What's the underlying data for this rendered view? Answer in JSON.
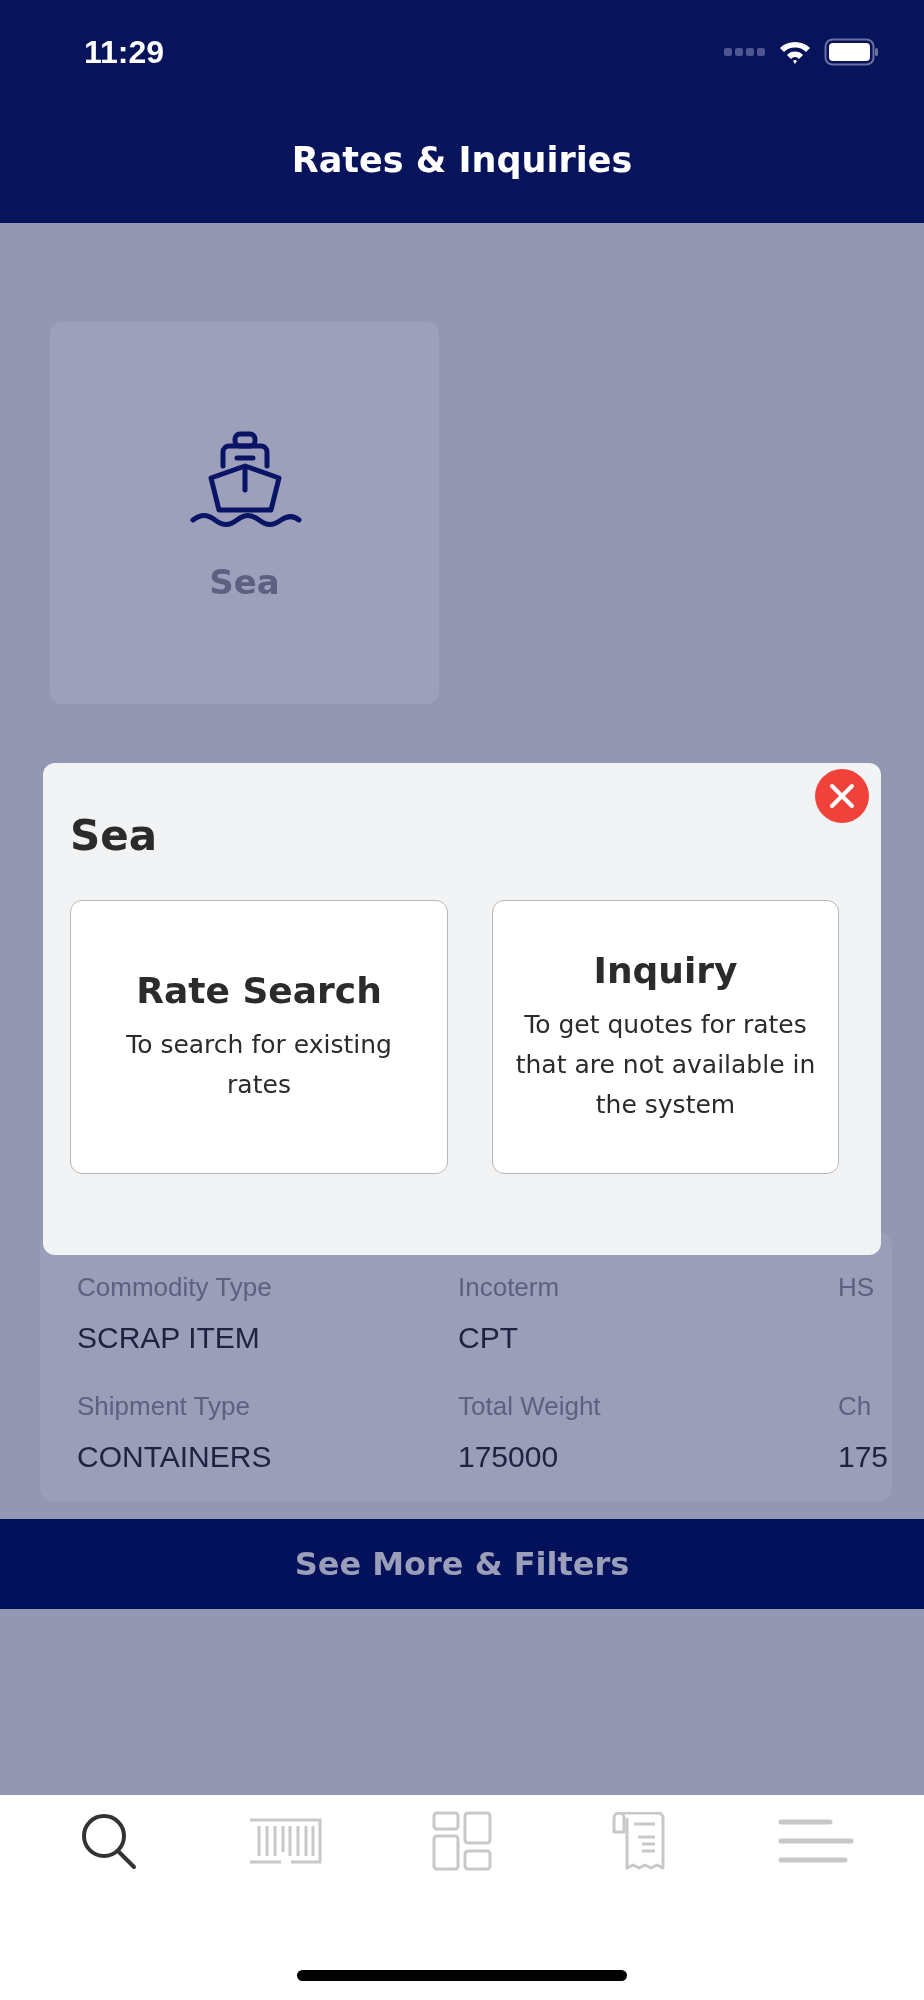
{
  "status_bar": {
    "time": "11:29"
  },
  "header": {
    "title": "Rates & Inquiries"
  },
  "modes": [
    {
      "label": "Sea",
      "kind": "ship"
    }
  ],
  "shipment_details": [
    {
      "label": "Commodity Type",
      "value": "SCRAP ITEM"
    },
    {
      "label": "Incoterm",
      "value": "CPT"
    },
    {
      "label": "HS"
    },
    {
      "label": "Shipment Type",
      "value": "CONTAINERS"
    },
    {
      "label": "Total Weight",
      "value": "175000"
    },
    {
      "label": "Ch",
      "value": "175"
    }
  ],
  "see_more_button": "See More & Filters",
  "modal": {
    "title": "Sea",
    "options": [
      {
        "title": "Rate Search",
        "description": "To search for existing rates"
      },
      {
        "title": "Inquiry",
        "description": "To get quotes for rates that are not available in the system"
      }
    ]
  },
  "tab_bar": [
    {
      "kind": "search",
      "selected": true
    },
    {
      "kind": "container",
      "selected": false
    },
    {
      "kind": "dashboard",
      "selected": false
    },
    {
      "kind": "receipt",
      "selected": false
    },
    {
      "kind": "menu",
      "selected": false
    }
  ]
}
